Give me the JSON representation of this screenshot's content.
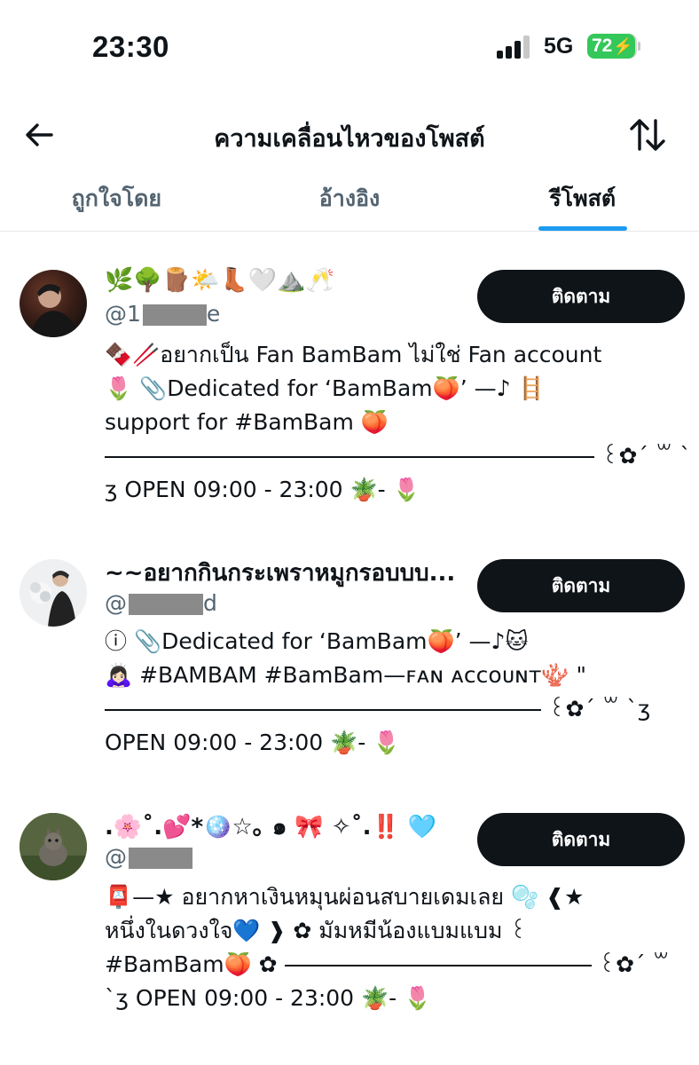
{
  "status_bar": {
    "time": "23:30",
    "network": "5G",
    "battery_level": "72",
    "battery_charging": true
  },
  "header": {
    "title": "ความเคลื่อนไหวของโพสต์",
    "back_icon": "arrow-left-icon",
    "sort_icon": "swap-vertical-icon"
  },
  "tabs": [
    {
      "label": "ถูกใจโดย",
      "active": false
    },
    {
      "label": "อ้างอิง",
      "active": false
    },
    {
      "label": "รีโพสต์",
      "active": true
    }
  ],
  "users": [
    {
      "display_name": "🌿🌳🪵🌤️👢🤍⛰️🥂",
      "handle_prefix": "@1",
      "handle_visible_suffix": "e",
      "follow_label": "ติดตาม",
      "bio_lines": [
        "🍫🥢อยากเป็น Fan BamBam ไม่ใช่ Fan account",
        "🌷 📎Dedicated for ‘BamBam🍑’ —♪ 🪜",
        "support for #BamBam 🍑",
        "꒰✿´ ꒳ `",
        "ʒ OPEN 09:00 - 23:00 🪴- 🌷"
      ]
    },
    {
      "display_name": "~~อยากกินกระเพราหมูกรอบบบ...",
      "handle_prefix": "@",
      "handle_visible_suffix": "d",
      "follow_label": "ติดตาม",
      "bio_lines": [
        "ⓘ 📎Dedicated for ‘BamBam🍑’ —♪🐱",
        "🙇🏻‍♀️ #BAMBAM #BamBam—ꜰᴀɴ ᴀᴄᴄᴏᴜɴᴛ🪸 \"",
        "꒰✿´ ꒳ `ʒ",
        "OPEN 09:00 - 23:00 🪴- 🌷"
      ]
    },
    {
      "display_name": ".🌸˚.💕*🪩☆｡ ๑ 🎀 ✧˚.‼️ 🩵",
      "handle_prefix": "@",
      "handle_visible_suffix": "",
      "follow_label": "ติดตาม",
      "bio_lines": [
        "📮—★ อยากหาเงินหมุนผ่อนสบายเดมเลย 🫧 ❰★",
        "หนึ่งในดวงใจ💙 ❱ ✿ มัมหมีน้องแบมแบม ꒰",
        "#BamBam🍑 ✿",
        "꒰✿´ ꒳",
        "`ʒ OPEN 09:00 - 23:00 🪴- 🌷"
      ]
    }
  ]
}
